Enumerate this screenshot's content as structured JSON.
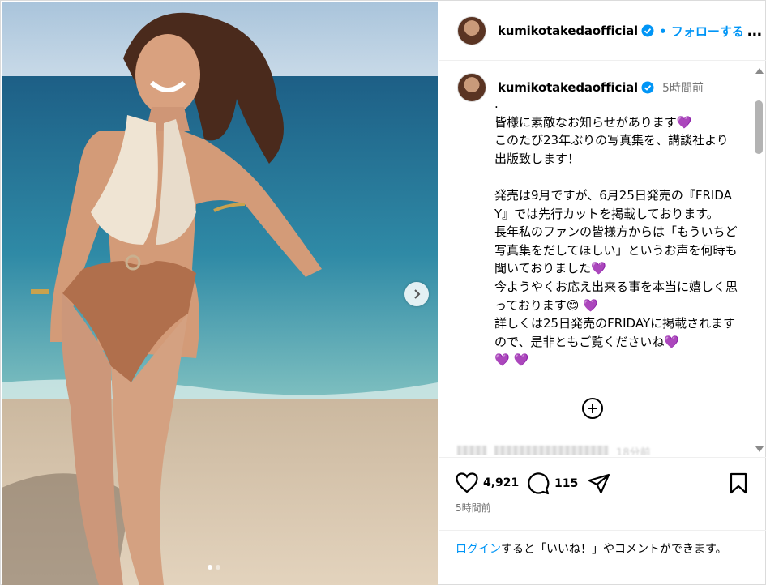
{
  "post": {
    "username": "kumikotakedaofficial",
    "follow_label": "フォローする",
    "follow_separator": "•",
    "more_label": "…",
    "caption": {
      "time_ago": "5時間前",
      "text": ".\n皆様に素敵なお知らせがあります💜\nこのたび23年ぶりの写真集を、講談社より出版致します！\n\n発売は9月ですが、6月25日発売の『FRIDAY』では先行カットを掲載しております。\n長年私のファンの皆様方からは「もういちど写真集をだしてほしい」というお声を何時も聞いておりました💜\n今ようやくお応え出来る事を本当に嬉しく思っております😊 💜\n詳しくは25日発売のFRIDAYに掲載されますので、是非ともご覧くださいね💜\n💜 💜"
    },
    "comment_preview_time": "18分前",
    "likes": "4,921",
    "comments_count": "115",
    "posted_time": "5時間前",
    "login_link": "ログイン",
    "login_rest": "すると「いいね！」やコメントができます。",
    "carousel": {
      "current": 1,
      "total": 2
    }
  },
  "colors": {
    "accent": "#0095f6",
    "verified": "#0095f6",
    "muted": "#737373"
  },
  "icons": [
    "verified-badge-icon",
    "more-options-icon",
    "chevron-right-icon",
    "add-comment-icon",
    "heart-icon",
    "comment-icon",
    "share-icon",
    "bookmark-icon"
  ]
}
